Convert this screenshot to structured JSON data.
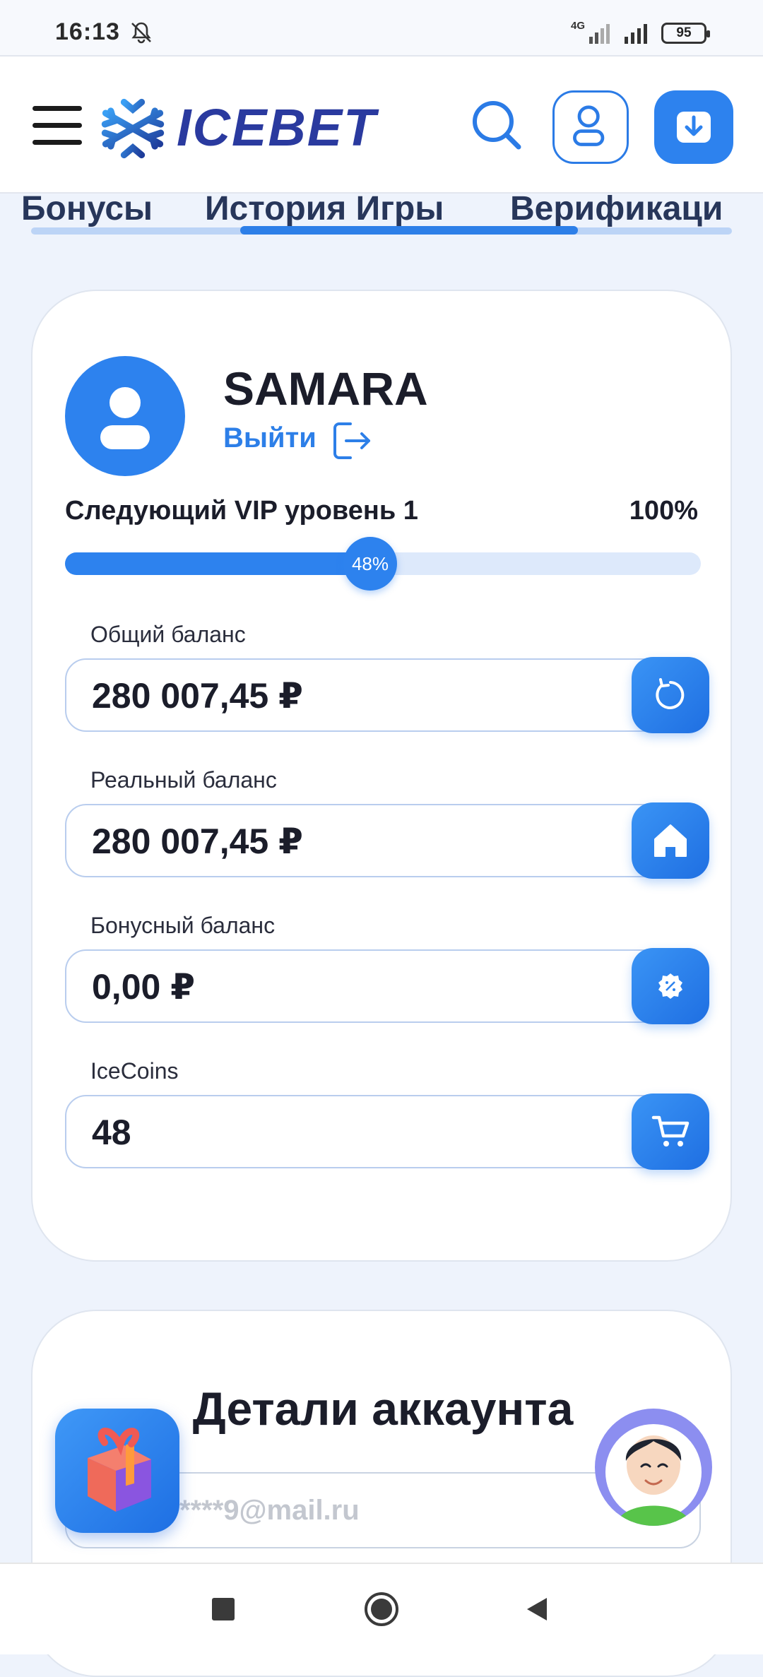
{
  "status_bar": {
    "time": "16:13",
    "network": "4G",
    "battery": "95"
  },
  "header": {
    "brand": "ICEBET"
  },
  "tabs": [
    {
      "label": "Бонусы"
    },
    {
      "label": "История Игры",
      "active": true
    },
    {
      "label": "Верификаци"
    }
  ],
  "profile": {
    "username": "SAMARA",
    "logout_label": "Выйти",
    "vip_label": "Следующий VIP уровень 1",
    "vip_target": "100%",
    "progress_label": "48%",
    "progress_value": 48
  },
  "balances": [
    {
      "label": "Общий баланс",
      "value": "280 007,45 ₽",
      "icon": "refresh-icon"
    },
    {
      "label": "Реальный баланс",
      "value": "280 007,45 ₽",
      "icon": "home-icon"
    },
    {
      "label": "Бонусный баланс",
      "value": "0,00 ₽",
      "icon": "discount-badge-icon"
    },
    {
      "label": "IceCoins",
      "value": "48",
      "icon": "cart-icon"
    }
  ],
  "account": {
    "title": "Детали аккаунта",
    "email": "****9@mail.ru"
  },
  "colors": {
    "accent": "#2d82ee",
    "brand_text": "#2a3a9f"
  }
}
